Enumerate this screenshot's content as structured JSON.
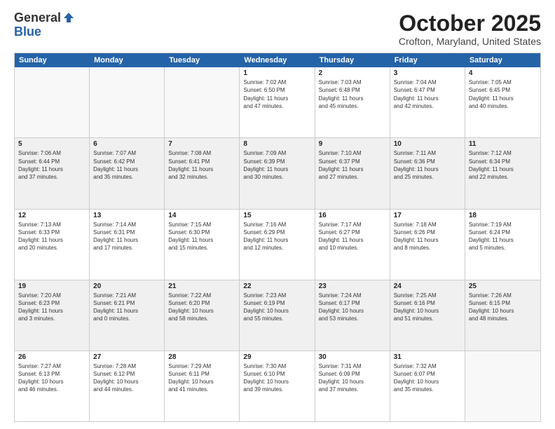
{
  "header": {
    "logo_general": "General",
    "logo_blue": "Blue",
    "month_title": "October 2025",
    "location": "Crofton, Maryland, United States"
  },
  "days_of_week": [
    "Sunday",
    "Monday",
    "Tuesday",
    "Wednesday",
    "Thursday",
    "Friday",
    "Saturday"
  ],
  "rows": [
    {
      "shaded": false,
      "cells": [
        {
          "day": "",
          "empty": true
        },
        {
          "day": "",
          "empty": true
        },
        {
          "day": "",
          "empty": true
        },
        {
          "day": "1",
          "info": "Sunrise: 7:02 AM\nSunset: 6:50 PM\nDaylight: 11 hours\nand 47 minutes."
        },
        {
          "day": "2",
          "info": "Sunrise: 7:03 AM\nSunset: 6:48 PM\nDaylight: 11 hours\nand 45 minutes."
        },
        {
          "day": "3",
          "info": "Sunrise: 7:04 AM\nSunset: 6:47 PM\nDaylight: 11 hours\nand 42 minutes."
        },
        {
          "day": "4",
          "info": "Sunrise: 7:05 AM\nSunset: 6:45 PM\nDaylight: 11 hours\nand 40 minutes."
        }
      ]
    },
    {
      "shaded": true,
      "cells": [
        {
          "day": "5",
          "info": "Sunrise: 7:06 AM\nSunset: 6:44 PM\nDaylight: 11 hours\nand 37 minutes."
        },
        {
          "day": "6",
          "info": "Sunrise: 7:07 AM\nSunset: 6:42 PM\nDaylight: 11 hours\nand 35 minutes."
        },
        {
          "day": "7",
          "info": "Sunrise: 7:08 AM\nSunset: 6:41 PM\nDaylight: 11 hours\nand 32 minutes."
        },
        {
          "day": "8",
          "info": "Sunrise: 7:09 AM\nSunset: 6:39 PM\nDaylight: 11 hours\nand 30 minutes."
        },
        {
          "day": "9",
          "info": "Sunrise: 7:10 AM\nSunset: 6:37 PM\nDaylight: 11 hours\nand 27 minutes."
        },
        {
          "day": "10",
          "info": "Sunrise: 7:11 AM\nSunset: 6:36 PM\nDaylight: 11 hours\nand 25 minutes."
        },
        {
          "day": "11",
          "info": "Sunrise: 7:12 AM\nSunset: 6:34 PM\nDaylight: 11 hours\nand 22 minutes."
        }
      ]
    },
    {
      "shaded": false,
      "cells": [
        {
          "day": "12",
          "info": "Sunrise: 7:13 AM\nSunset: 6:33 PM\nDaylight: 11 hours\nand 20 minutes."
        },
        {
          "day": "13",
          "info": "Sunrise: 7:14 AM\nSunset: 6:31 PM\nDaylight: 11 hours\nand 17 minutes."
        },
        {
          "day": "14",
          "info": "Sunrise: 7:15 AM\nSunset: 6:30 PM\nDaylight: 11 hours\nand 15 minutes."
        },
        {
          "day": "15",
          "info": "Sunrise: 7:16 AM\nSunset: 6:29 PM\nDaylight: 11 hours\nand 12 minutes."
        },
        {
          "day": "16",
          "info": "Sunrise: 7:17 AM\nSunset: 6:27 PM\nDaylight: 11 hours\nand 10 minutes."
        },
        {
          "day": "17",
          "info": "Sunrise: 7:18 AM\nSunset: 6:26 PM\nDaylight: 11 hours\nand 8 minutes."
        },
        {
          "day": "18",
          "info": "Sunrise: 7:19 AM\nSunset: 6:24 PM\nDaylight: 11 hours\nand 5 minutes."
        }
      ]
    },
    {
      "shaded": true,
      "cells": [
        {
          "day": "19",
          "info": "Sunrise: 7:20 AM\nSunset: 6:23 PM\nDaylight: 11 hours\nand 3 minutes."
        },
        {
          "day": "20",
          "info": "Sunrise: 7:21 AM\nSunset: 6:21 PM\nDaylight: 11 hours\nand 0 minutes."
        },
        {
          "day": "21",
          "info": "Sunrise: 7:22 AM\nSunset: 6:20 PM\nDaylight: 10 hours\nand 58 minutes."
        },
        {
          "day": "22",
          "info": "Sunrise: 7:23 AM\nSunset: 6:19 PM\nDaylight: 10 hours\nand 55 minutes."
        },
        {
          "day": "23",
          "info": "Sunrise: 7:24 AM\nSunset: 6:17 PM\nDaylight: 10 hours\nand 53 minutes."
        },
        {
          "day": "24",
          "info": "Sunrise: 7:25 AM\nSunset: 6:16 PM\nDaylight: 10 hours\nand 51 minutes."
        },
        {
          "day": "25",
          "info": "Sunrise: 7:26 AM\nSunset: 6:15 PM\nDaylight: 10 hours\nand 48 minutes."
        }
      ]
    },
    {
      "shaded": false,
      "cells": [
        {
          "day": "26",
          "info": "Sunrise: 7:27 AM\nSunset: 6:13 PM\nDaylight: 10 hours\nand 46 minutes."
        },
        {
          "day": "27",
          "info": "Sunrise: 7:28 AM\nSunset: 6:12 PM\nDaylight: 10 hours\nand 44 minutes."
        },
        {
          "day": "28",
          "info": "Sunrise: 7:29 AM\nSunset: 6:11 PM\nDaylight: 10 hours\nand 41 minutes."
        },
        {
          "day": "29",
          "info": "Sunrise: 7:30 AM\nSunset: 6:10 PM\nDaylight: 10 hours\nand 39 minutes."
        },
        {
          "day": "30",
          "info": "Sunrise: 7:31 AM\nSunset: 6:09 PM\nDaylight: 10 hours\nand 37 minutes."
        },
        {
          "day": "31",
          "info": "Sunrise: 7:32 AM\nSunset: 6:07 PM\nDaylight: 10 hours\nand 35 minutes."
        },
        {
          "day": "",
          "empty": true
        }
      ]
    }
  ]
}
